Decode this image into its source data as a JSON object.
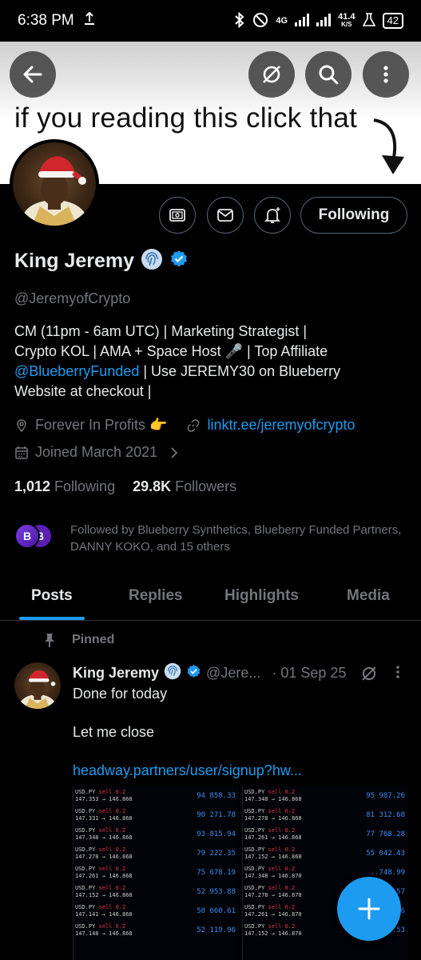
{
  "status_bar": {
    "time": "6:38 PM",
    "net_speed_value": "41.4",
    "net_speed_unit": "K/S",
    "network": "4G",
    "battery": "42"
  },
  "banner": {
    "text": "if you reading this click that"
  },
  "profile": {
    "name": "King Jeremy",
    "handle": "@JeremyofCrypto",
    "bio_line1": "CM (11pm - 6am UTC) | Marketing Strategist |",
    "bio_line2": "Crypto KOL | AMA + Space Host 🎤 | Top Affiliate",
    "bio_mention": "@BlueberryFunded",
    "bio_line3_rest": " | Use JEREMY30 on Blueberry",
    "bio_line4": "Website at checkout |",
    "location": "Forever In Profits 👉",
    "website": "linktr.ee/jeremyofcrypto",
    "joined": "Joined March 2021",
    "following_count": "1,012",
    "following_label": "Following",
    "followers_count": "29.8K",
    "followers_label": "Followers",
    "followed_by": "Followed by Blueberry Synthetics, Blueberry Funded Partners, DANNY KOKO, and 15 others",
    "follow_button": "Following"
  },
  "tabs": [
    {
      "label": "Posts",
      "active": true
    },
    {
      "label": "Replies",
      "active": false
    },
    {
      "label": "Highlights",
      "active": false
    },
    {
      "label": "Media",
      "active": false
    }
  ],
  "post": {
    "pinned_label": "Pinned",
    "author_name": "King Jeremy",
    "author_handle": "@Jere...",
    "date": "· 01 Sep 25",
    "line1": "Done for today",
    "line2": "Let me close",
    "link": "headway.partners/user/signup?hw...",
    "trades_left": [
      {
        "pair": "USD.PY",
        "action": "sell 0.2",
        "prices": "147.353 → 146.868",
        "value": "94 858.33"
      },
      {
        "pair": "USD.PY",
        "action": "sell 0.2",
        "prices": "147.331 → 146.868",
        "value": "90 271.78"
      },
      {
        "pair": "USD.PY",
        "action": "sell 0.2",
        "prices": "147.348 → 146.868",
        "value": "93 815.94"
      },
      {
        "pair": "USD.PY",
        "action": "sell 0.2",
        "prices": "147.278 → 146.868",
        "value": "79 222.35"
      },
      {
        "pair": "USD.PY",
        "action": "sell 0.2",
        "prices": "147.261 → 146.868",
        "value": "75 678.19"
      },
      {
        "pair": "USD.PY",
        "action": "sell 0.2",
        "prices": "147.152 → 146.868",
        "value": "52 953.88"
      },
      {
        "pair": "USD.PY",
        "action": "sell 0.2",
        "prices": "147.141 → 146.868",
        "value": "50 660.61"
      },
      {
        "pair": "USD.PY",
        "action": "sell 0.2",
        "prices": "147.148 → 146.868",
        "value": "52 119.96"
      }
    ],
    "trades_right": [
      {
        "pair": "USD.PY",
        "action": "sell 0.2",
        "prices": "147.348 → 146.868",
        "value": "95 907.26"
      },
      {
        "pair": "USD.PY",
        "action": "sell 0.2",
        "prices": "147.278 → 146.868",
        "value": "81 312.68"
      },
      {
        "pair": "USD.PY",
        "action": "sell 0.2",
        "prices": "147.261 → 146.868",
        "value": "77 768.28"
      },
      {
        "pair": "USD.PY",
        "action": "sell 0.2",
        "prices": "147.152 → 146.868",
        "value": "55 042.43"
      },
      {
        "pair": "USD.PY",
        "action": "sell 0.2",
        "prices": "147.348 → 146.870",
        "value": "..748.99"
      },
      {
        "pair": "USD.PY",
        "action": "sell 0.2",
        "prices": "147.278 → 146.870",
        "value": "..57"
      },
      {
        "pair": "USD.PY",
        "action": "sell 0.2",
        "prices": "147.261 → 146.870",
        "value": "..1.16"
      },
      {
        "pair": "USD.PY",
        "action": "sell 0.2",
        "prices": "147.152 → 146.870",
        "value": "58 802.53"
      }
    ]
  },
  "colors": {
    "accent": "#1d9bf0",
    "muted": "#71767b",
    "background": "#000000"
  }
}
